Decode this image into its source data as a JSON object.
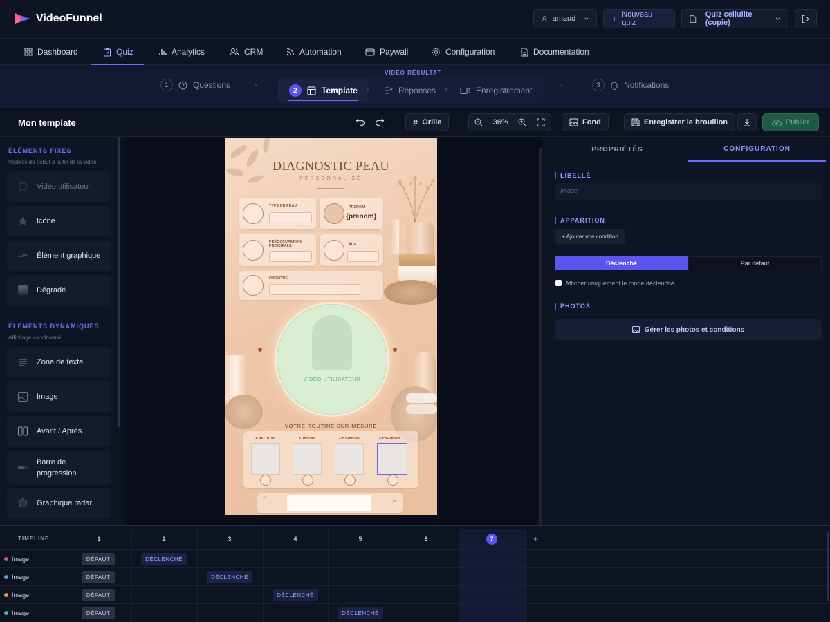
{
  "app": {
    "name": "VideoFunnel"
  },
  "topbar": {
    "user": "amaud",
    "new_quiz": "Nouveau quiz",
    "quiz_name": "Quiz cellulite (copie)"
  },
  "nav": [
    "Dashboard",
    "Quiz",
    "Analytics",
    "CRM",
    "Automation",
    "Paywall",
    "Configuration",
    "Documentation"
  ],
  "stepper": {
    "video_label": "VIDÉO RÉSULTAT",
    "steps": [
      {
        "num": "1",
        "label": "Questions"
      },
      {
        "num": "2",
        "label": "Template"
      },
      {
        "label": "Réponses"
      },
      {
        "label": "Enregistrement"
      },
      {
        "num": "3",
        "label": "Notifications"
      }
    ]
  },
  "toolbar": {
    "title": "Mon template",
    "grid": "Grille",
    "zoom": "36%",
    "background": "Fond",
    "save_draft": "Enregistrer le brouillon",
    "publish": "Publier"
  },
  "left_panel": {
    "fixed_title": "ÉLÉMENTS FIXES",
    "fixed_sub": "Visibles du début à la fin de la vidéo",
    "fixed_items": [
      "Vidéo utilisateur",
      "Icône",
      "Élément graphique",
      "Dégradé"
    ],
    "dynamic_title": "ÉLÉMENTS DYNAMIQUES",
    "dynamic_sub": "Affichage conditionné",
    "dynamic_items": [
      "Zone de texte",
      "Image",
      "Avant / Après",
      "Barre de progression",
      "Graphique radar"
    ]
  },
  "canvas": {
    "title": "DIAGNOSTIC PEAU",
    "subtitle": "PERSONNALISÉ",
    "fields": {
      "skin_type": "TYPE DE PEAU",
      "first_name": "PRÉNOM",
      "first_name_value": "{prenom}",
      "concern": "PRÉOCCUPATION PRINCIPALE",
      "age": "ÂGE",
      "goal": "OBJECTIF"
    },
    "video_label": "VIDÉO UTILISATEUR",
    "routine_title": "VOTRE ROUTINE SUR-MESURE",
    "routine_steps": [
      "1. NETTOYER",
      "2. TRAITER",
      "3. HYDRATER",
      "4. PROTÉGER"
    ]
  },
  "right_panel": {
    "tabs": [
      "PROPRIÉTÉS",
      "CONFIGURATION"
    ],
    "label_title": "LIBELLÉ",
    "label_placeholder": "Image",
    "appearance_title": "APPARITION",
    "add_condition": "+ Ajouter une condition",
    "mode_triggered": "Déclenché",
    "mode_default": "Par défaut",
    "only_triggered": "Afficher uniquement le mode déclenché",
    "photos_title": "PHOTOS",
    "manage_photos": "Gérer les photos et conditions"
  },
  "timeline": {
    "title": "TIMELINE",
    "columns": [
      "1",
      "2",
      "3",
      "4",
      "5",
      "6",
      "7"
    ],
    "add": "+",
    "default_label": "DÉFAUT",
    "triggered_label": "DÉCLENCHÉ",
    "rows": [
      {
        "name": "Image",
        "color": "#e0566e"
      },
      {
        "name": "Image",
        "color": "#4da3f0"
      },
      {
        "name": "Image",
        "color": "#e9a23b"
      },
      {
        "name": "Image",
        "color": "#3fc97e"
      }
    ]
  },
  "colors": {
    "accent": "#5b55ef",
    "publish": "#1e5a45",
    "bg": "#0e1322"
  }
}
